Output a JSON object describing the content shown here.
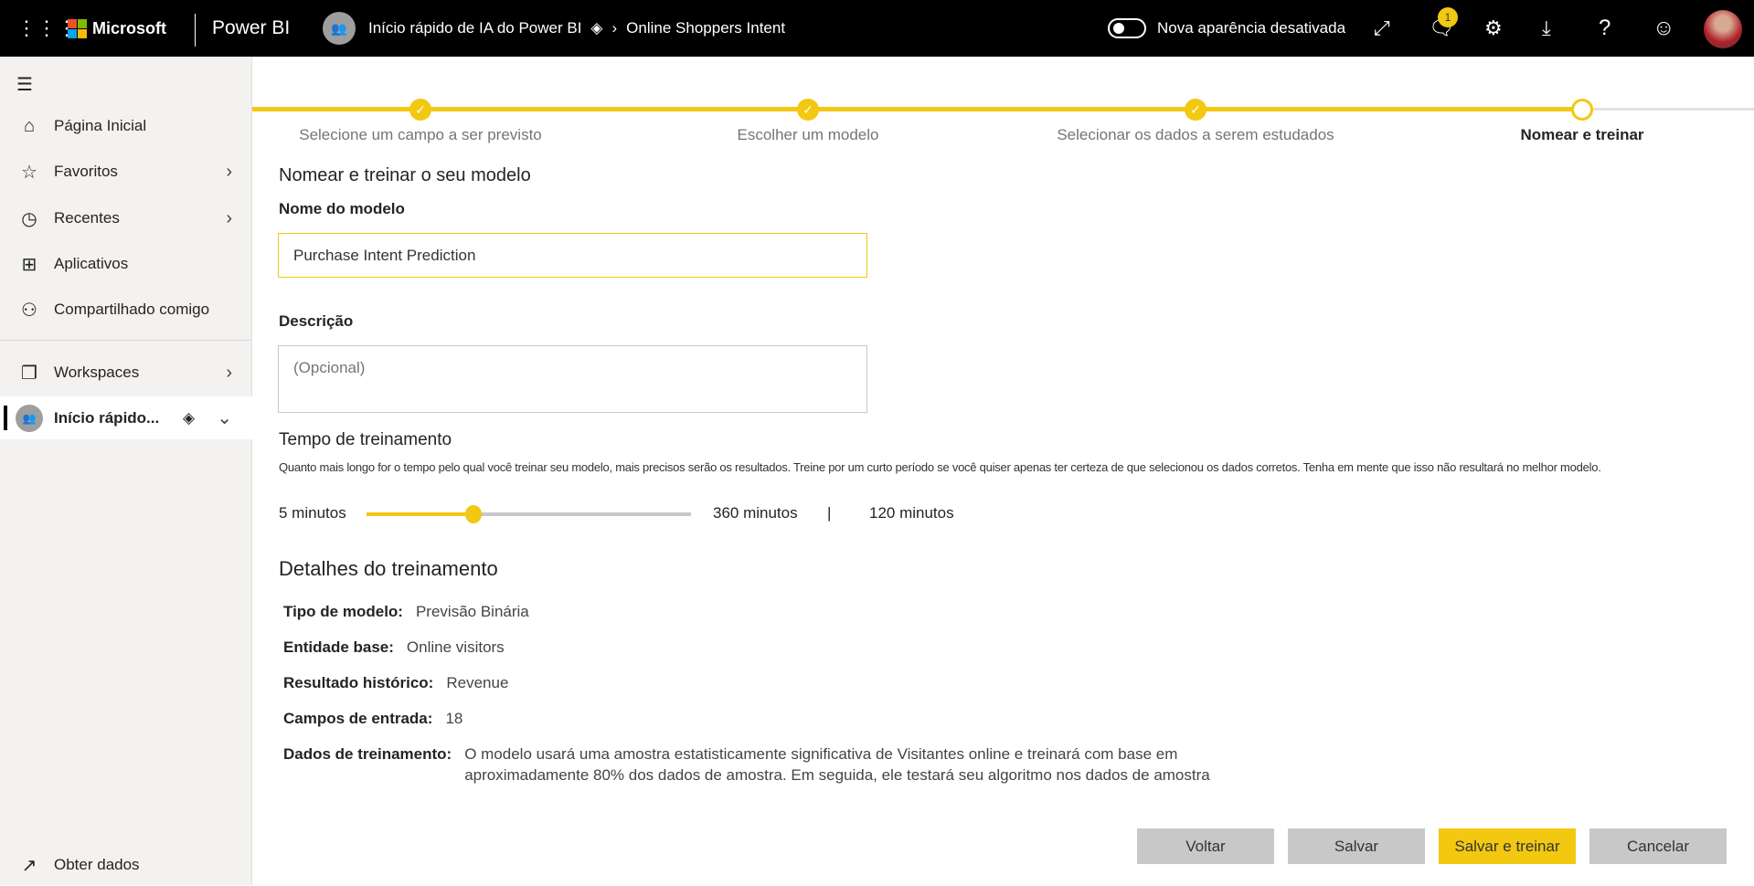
{
  "header": {
    "app_brand": "Microsoft",
    "product": "Power BI",
    "workspace": "Início rápido de IA do Power BI",
    "page": "Online Shoppers Intent",
    "toggle_label": "Nova aparência desativada",
    "notification_count": "1"
  },
  "sidebar": {
    "items": [
      {
        "label": "Página Inicial"
      },
      {
        "label": "Favoritos"
      },
      {
        "label": "Recentes"
      },
      {
        "label": "Aplicativos"
      },
      {
        "label": "Compartilhado comigo"
      },
      {
        "label": "Workspaces"
      },
      {
        "label": "Início rápido..."
      }
    ],
    "get_data": "Obter dados"
  },
  "stepper": {
    "steps": [
      "Selecione um campo a ser previsto",
      "Escolher um modelo",
      "Selecionar os dados a serem estudados",
      "Nomear e treinar"
    ],
    "current": 4
  },
  "form": {
    "title": "Nomear e treinar o seu modelo",
    "name_label": "Nome do modelo",
    "name_value": "Purchase Intent Prediction",
    "desc_label": "Descrição",
    "desc_placeholder": "(Opcional)",
    "time_label": "Tempo de treinamento",
    "time_help": "Quanto mais longo for o tempo pelo qual você treinar seu modelo, mais precisos serão os resultados. Treine por um curto período se você quiser apenas ter certeza de que selecionou os dados corretos. Tenha em mente que isso não resultará no melhor modelo.",
    "slider_min": "5 minutos",
    "slider_max": "360 minutos",
    "slider_sep": "|",
    "slider_value": "120 minutos",
    "slider_fraction": 0.33
  },
  "details": {
    "title": "Detalhes do treinamento",
    "rows": [
      {
        "label": "Tipo de modelo:",
        "value": "Previsão Binária"
      },
      {
        "label": "Entidade base:",
        "value": "Online visitors"
      },
      {
        "label": "Resultado histórico:",
        "value": "Revenue"
      },
      {
        "label": "Campos de entrada:",
        "value": "18"
      },
      {
        "label": "Dados de treinamento:",
        "value": "O modelo usará uma amostra estatisticamente significativa de Visitantes online e treinará com base em aproximadamente 80% dos dados de amostra. Em seguida, ele testará seu algoritmo nos dados de amostra"
      }
    ]
  },
  "buttons": {
    "back": "Voltar",
    "save": "Salvar",
    "save_train": "Salvar e treinar",
    "cancel": "Cancelar"
  },
  "colors": {
    "accent": "#f2c811",
    "header": "#000000",
    "sidebar": "#f3f2f1"
  }
}
